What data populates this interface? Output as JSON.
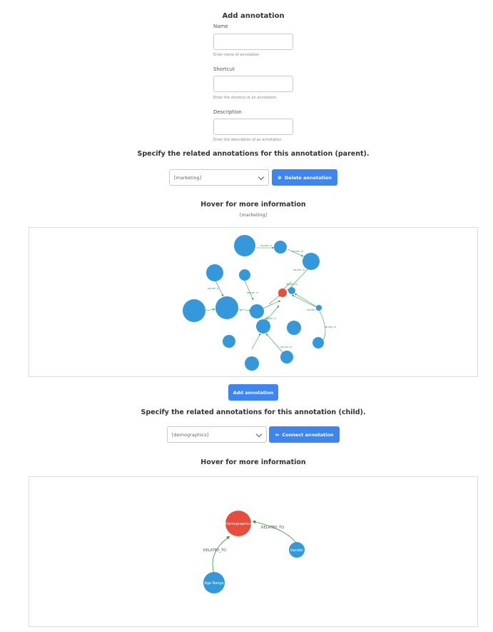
{
  "form": {
    "heading": "Add annotation",
    "name_label": "Name",
    "name_hint": "Enter name of annotation",
    "shortcut_label": "Shortcut",
    "shortcut_hint": "Enter the shortcut of an annotation",
    "description_label": "Description",
    "description_hint": "Enter the description of an annotation"
  },
  "parent": {
    "heading": "Specify the related annotations for this annotation (parent).",
    "selected": "[marketing]",
    "delete_label": "Delete annotation",
    "delete_icon": "trash-icon",
    "hover_heading": "Hover for more information",
    "hover_sub": "[marketing]"
  },
  "add_button": "Add annotation",
  "child": {
    "heading": "Specify the related annotations for this annotation (child).",
    "selected": "[demographics]",
    "connect_label": "Connect annotation",
    "connect_icon": "link-arrows-icon",
    "hover_heading": "Hover for more information",
    "graph": {
      "nodes": [
        {
          "id": "demographics",
          "label": "Demographics",
          "color": "#e74c3c"
        },
        {
          "id": "gender",
          "label": "Gender",
          "color": "#3498db"
        },
        {
          "id": "age",
          "label": "Age Range",
          "color": "#3498db"
        }
      ],
      "edges": [
        {
          "from": "gender",
          "to": "demographics",
          "label": "RELATED_TO"
        },
        {
          "from": "age",
          "to": "demographics",
          "label": "RELATED_TO"
        }
      ]
    }
  },
  "colors": {
    "accent": "#3d86f0",
    "node_blue": "#3498db",
    "node_red": "#e74c3c",
    "edge_green": "#2e9e3a"
  }
}
